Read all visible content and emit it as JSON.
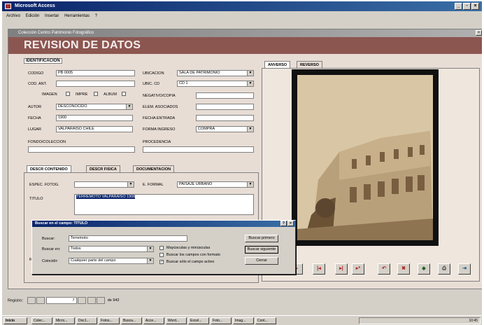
{
  "app": {
    "title": "Microsoft Access",
    "menu": [
      "Archivo",
      "Edición",
      "Insertar",
      "Herramientas",
      "?"
    ]
  },
  "form": {
    "window_title": "Colección Centro Patrimonio Fotográfico",
    "header": "REVISION DE DATOS",
    "identificacion": {
      "title": "IDENTIFICACION",
      "codigo_label": "CODIGO",
      "codigo_value": "PB 0005",
      "cod_ant_label": "COD. ANT.",
      "cod_ant_value": "",
      "checks": [
        "IMAGEN",
        "IMPRE",
        "ALBUM"
      ],
      "autor_label": "AUTOR",
      "autor_value": "DESCONOCIDO",
      "fecha_label": "FECHA",
      "fecha_value": "1900",
      "lugar_label": "LUGAR",
      "lugar_value": "VALPARAISO CHILE",
      "fondo_label": "FONDO/COLECCION",
      "fondo_value": "",
      "ubicacion_label": "UBICACION",
      "ubicacion_value": "SALA DE PATRIMONIO",
      "ubic_cd_label": "UBIC. CD",
      "ubic_cd_value": "CD 1",
      "negativo_label": "NEGATIVO/COPIA",
      "negativo_value": "",
      "elem_label": "ELEM. ASOCIADOS",
      "elem_value": "",
      "fecha_entrada_label": "FECHA ENTRADA",
      "fecha_entrada_value": "",
      "forma_label": "FORMA INGRESO",
      "forma_value": "COMPRA",
      "procedencia_label": "PROCEDENCIA",
      "procedencia_value": ""
    },
    "tabs": [
      "DESCR CONTENIDO",
      "DESCR FISICA",
      "DOCUMENTACION"
    ],
    "descr": {
      "espec_label": "ESPEC. FOTOG.",
      "espec_value": "",
      "e_formal_label": "E. FORMAL",
      "e_formal_value": "PAISAJE URBANO",
      "titulo_label": "TITULO",
      "titulo_value": "TERREMOTO VALPARAISO 1906",
      "r_label": "R"
    },
    "image_tabs": [
      "ANVERSO",
      "REVERSO"
    ],
    "nav_buttons": [
      "◂",
      "▸",
      "|◂",
      "▸|",
      "▸*"
    ],
    "tool_buttons": [
      "↶",
      "✖",
      "◆",
      "⎙",
      "⇥"
    ]
  },
  "dialog": {
    "title": "Buscar en el campo: TITULO",
    "buscar_label": "Buscar:",
    "buscar_value": "Terremoto",
    "buscar_en_label": "Buscar en:",
    "buscar_en_value": "Todos",
    "coincidir_label": "Coincidir:",
    "coincidir_value": "Cualquier parte del campo",
    "options": [
      {
        "label": "Mayúsculas y minúsculas",
        "checked": false
      },
      {
        "label": "Buscar los campos con formato",
        "checked": false
      },
      {
        "label": "Buscar sólo el campo activo",
        "checked": true
      }
    ],
    "btn_primero": "Buscar primero",
    "btn_siguiente": "Buscar siguiente",
    "btn_cerrar": "Cerrar"
  },
  "records": {
    "label": "Registro:",
    "current": "7",
    "total": "de 942"
  },
  "taskbar": {
    "start": "Inicio",
    "items": [
      "Colec...",
      "Micro...",
      "Doc1...",
      "Fotos...",
      "Busca...",
      "Acce...",
      "Word...",
      "Excel...",
      "Foto...",
      "Imag...",
      "Cont..."
    ],
    "clock": "10:45"
  }
}
